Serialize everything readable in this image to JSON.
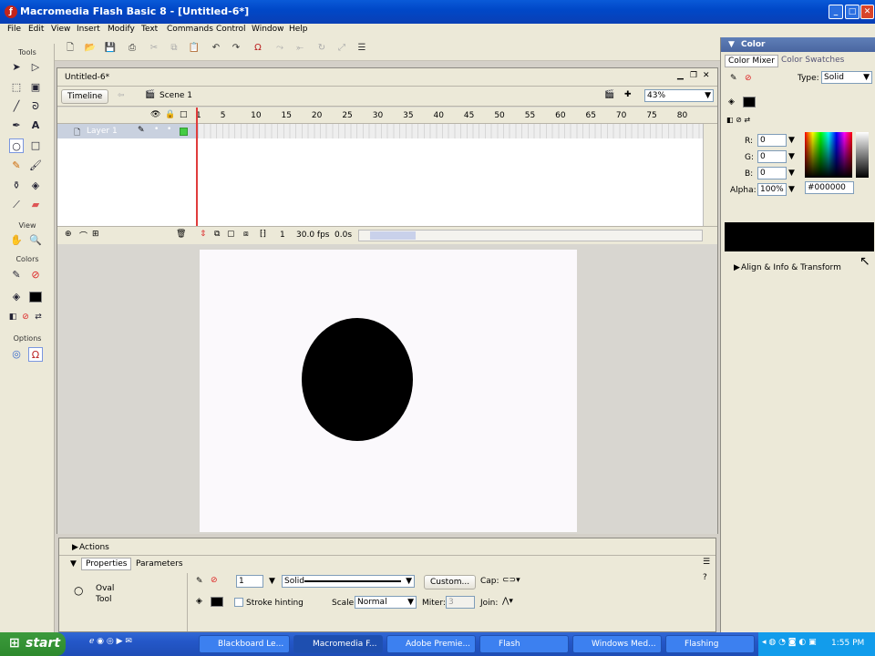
{
  "window": {
    "title": "Macromedia Flash Basic 8 - [Untitled-6*]"
  },
  "menu": [
    "File",
    "Edit",
    "View",
    "Insert",
    "Modify",
    "Text",
    "Commands",
    "Control",
    "Window",
    "Help"
  ],
  "tools": {
    "label": "Tools",
    "view_label": "View",
    "colors_label": "Colors",
    "options_label": "Options"
  },
  "document": {
    "tab": "Untitled-6*",
    "timeline_button": "Timeline",
    "scene": "Scene 1",
    "zoom": "43%",
    "frame_numbers": [
      "1",
      "5",
      "10",
      "15",
      "20",
      "25",
      "30",
      "35",
      "40",
      "45",
      "50",
      "55",
      "60",
      "65",
      "70",
      "75",
      "80"
    ],
    "layer_name": "Layer 1",
    "current_frame": "1",
    "fps": "30.0 fps",
    "time": "0.0s"
  },
  "color_panel": {
    "title": "Color",
    "tab_mixer": "Color Mixer",
    "tab_swatches": "Color Swatches",
    "type_label": "Type:",
    "type_value": "Solid",
    "r_label": "R:",
    "r": "0",
    "g_label": "G:",
    "g": "0",
    "b_label": "B:",
    "b": "0",
    "alpha_label": "Alpha:",
    "alpha": "100%",
    "hex": "#000000",
    "align_panel": "Align & Info & Transform"
  },
  "properties": {
    "actions": "Actions",
    "tab_properties": "Properties",
    "tab_parameters": "Parameters",
    "tool_name_1": "Oval",
    "tool_name_2": "Tool",
    "stroke_height": "1",
    "stroke_style": "Solid",
    "custom_button": "Custom...",
    "cap_label": "Cap:",
    "stroke_hinting": "Stroke hinting",
    "scale_label": "Scale:",
    "scale_value": "Normal",
    "miter_label": "Miter:",
    "miter_value": "3",
    "join_label": "Join:"
  },
  "taskbar": {
    "start": "start",
    "tasks": [
      "Blackboard Le...",
      "Macromedia F...",
      "Adobe Premie...",
      "Flash",
      "Windows Med...",
      "Flashing"
    ],
    "clock": "1:55 PM"
  },
  "colors": {
    "accent": "#0a5ad8",
    "fill": "#000000",
    "stage": "#fbf9fc"
  }
}
